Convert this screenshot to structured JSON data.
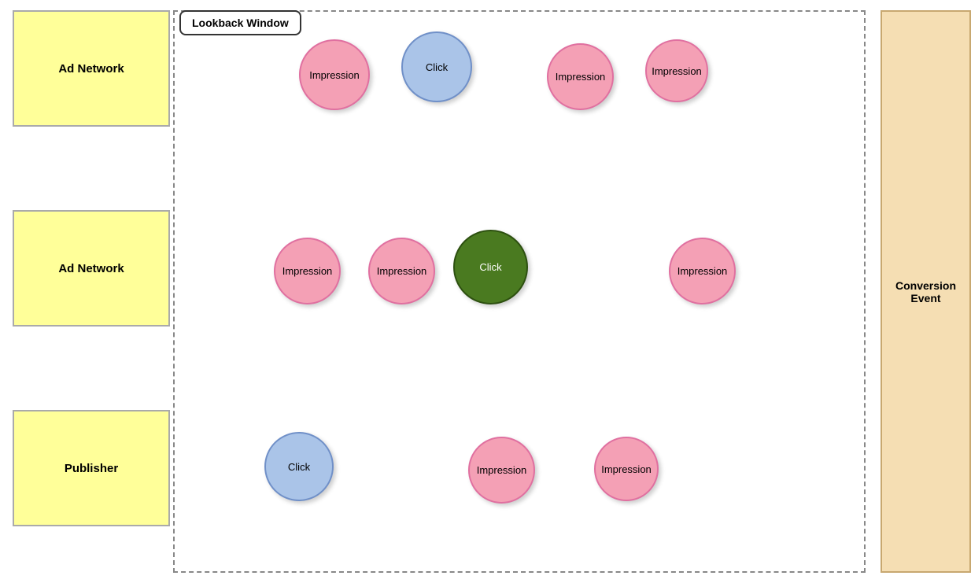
{
  "labels": {
    "lookback_window": "Lookback Window",
    "conversion_event": "Conversion\nEvent",
    "ad_network_1": "Ad Network",
    "ad_network_2": "Ad Network",
    "publisher": "Publisher"
  },
  "circles": {
    "row1": {
      "imp1": "Impression",
      "click": "Click",
      "imp2": "Impression",
      "imp3": "Impression"
    },
    "row2": {
      "imp1": "Impression",
      "imp2": "Impression",
      "click": "Click",
      "imp3": "Impression"
    },
    "row3": {
      "click": "Click",
      "imp1": "Impression",
      "imp2": "Impression"
    }
  },
  "colors": {
    "box_yellow": "#ffff99",
    "box_border": "#aaa",
    "circle_pink": "#f4a0b5",
    "circle_blue": "#aac4e8",
    "circle_green": "#4a7a20",
    "conversion_bg": "#f5deb3"
  }
}
